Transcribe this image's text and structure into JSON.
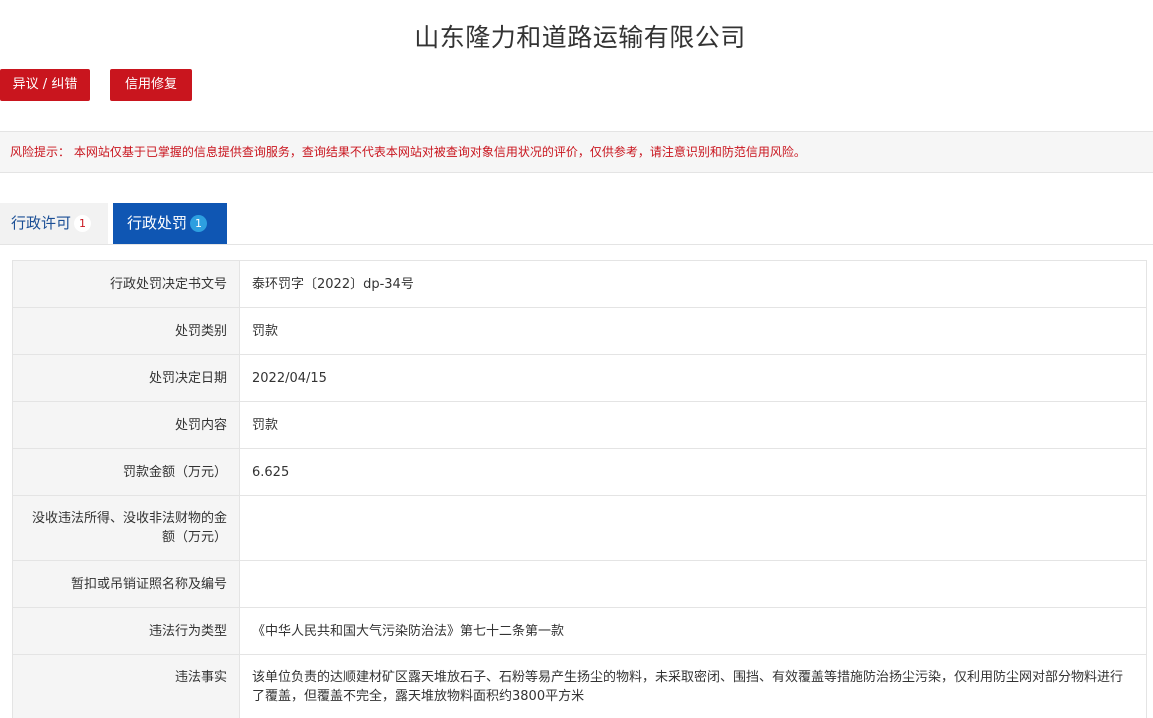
{
  "company": {
    "name": "山东隆力和道路运输有限公司"
  },
  "actions": {
    "objection_label": "异议 / 纠错",
    "repair_label": "信用修复"
  },
  "risk_notice": {
    "prefix": "风险提示：",
    "text": "本网站仅基于已掌握的信息提供查询服务，查询结果不代表本网站对被查询对象信用状况的评价，仅供参考，请注意识别和防范信用风险。"
  },
  "tabs": [
    {
      "label": "行政许可",
      "count": "1",
      "active": false
    },
    {
      "label": "行政处罚",
      "count": "1",
      "active": true
    }
  ],
  "penalty_detail": {
    "rows": [
      {
        "label": "行政处罚决定书文号",
        "value": "泰环罚字〔2022〕dp-34号"
      },
      {
        "label": "处罚类别",
        "value": "罚款"
      },
      {
        "label": "处罚决定日期",
        "value": "2022/04/15"
      },
      {
        "label": "处罚内容",
        "value": "罚款"
      },
      {
        "label": "罚款金额（万元）",
        "value": "6.625"
      },
      {
        "label": "没收违法所得、没收非法财物的金额（万元）",
        "value": ""
      },
      {
        "label": "暂扣或吊销证照名称及编号",
        "value": ""
      },
      {
        "label": "违法行为类型",
        "value": "《中华人民共和国大气污染防治法》第七十二条第一款"
      },
      {
        "label": "违法事实",
        "value": "该单位负责的达顺建材矿区露天堆放石子、石粉等易产生扬尘的物料，未采取密闭、围挡、有效覆盖等措施防治扬尘污染，仅利用防尘网对部分物料进行了覆盖，但覆盖不完全，露天堆放物料面积约3800平方米"
      }
    ]
  },
  "colors": {
    "brand_red": "#c9151e",
    "tab_active_blue": "#0f56b3",
    "tab_inactive_text": "#1a4e95"
  }
}
